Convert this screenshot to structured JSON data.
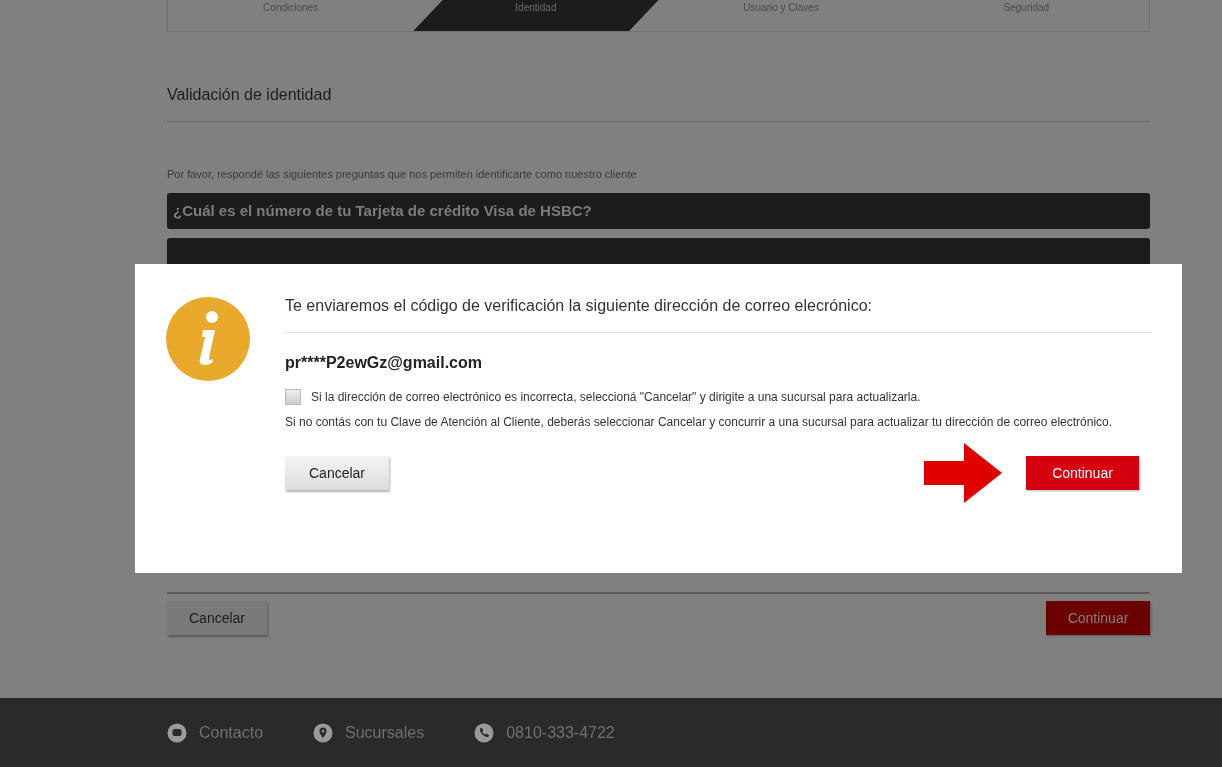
{
  "steps": [
    {
      "label": "Condiciones",
      "selected": false
    },
    {
      "label": "Identidad",
      "selected": true
    },
    {
      "label": "Usuario y Claves",
      "selected": false
    },
    {
      "label": "Seguridad",
      "selected": false
    }
  ],
  "section_title": "Validación de identidad",
  "intro": "Por favor, respondé las siguientes preguntas que nos permiten identificarte como nuestro cliente",
  "question": "¿Cuál es el número de tu Tarjeta de crédito Visa de HSBC?",
  "dialog": {
    "message": "Te enviaremos el código de verificación la siguiente dirección de correo elecrónico:",
    "email": "pr****P2ewGz@gmail.com",
    "checkbox": {
      "label": "Si la dirección de correo electrónico es incorrecta, seleccioná \"Cancelar\" y dirigite a una sucursal para actualizarla.",
      "checked": false
    },
    "note": "Si no contás con tu Clave de Atención al Cliente, deberás seleccionar Cancelar y concurrir a una sucursal para actualizar tu dirección de correo electrónico.",
    "cancel_button": "Cancelar",
    "continue_button": "Continuar"
  },
  "cancel_button": "Cancelar",
  "continue_button": "Continuar",
  "footer": [
    {
      "kind": "chat",
      "label": "Contacto"
    },
    {
      "kind": "pin",
      "label": "Sucursales"
    },
    {
      "kind": "phone",
      "label": "0810-333-4722"
    }
  ]
}
